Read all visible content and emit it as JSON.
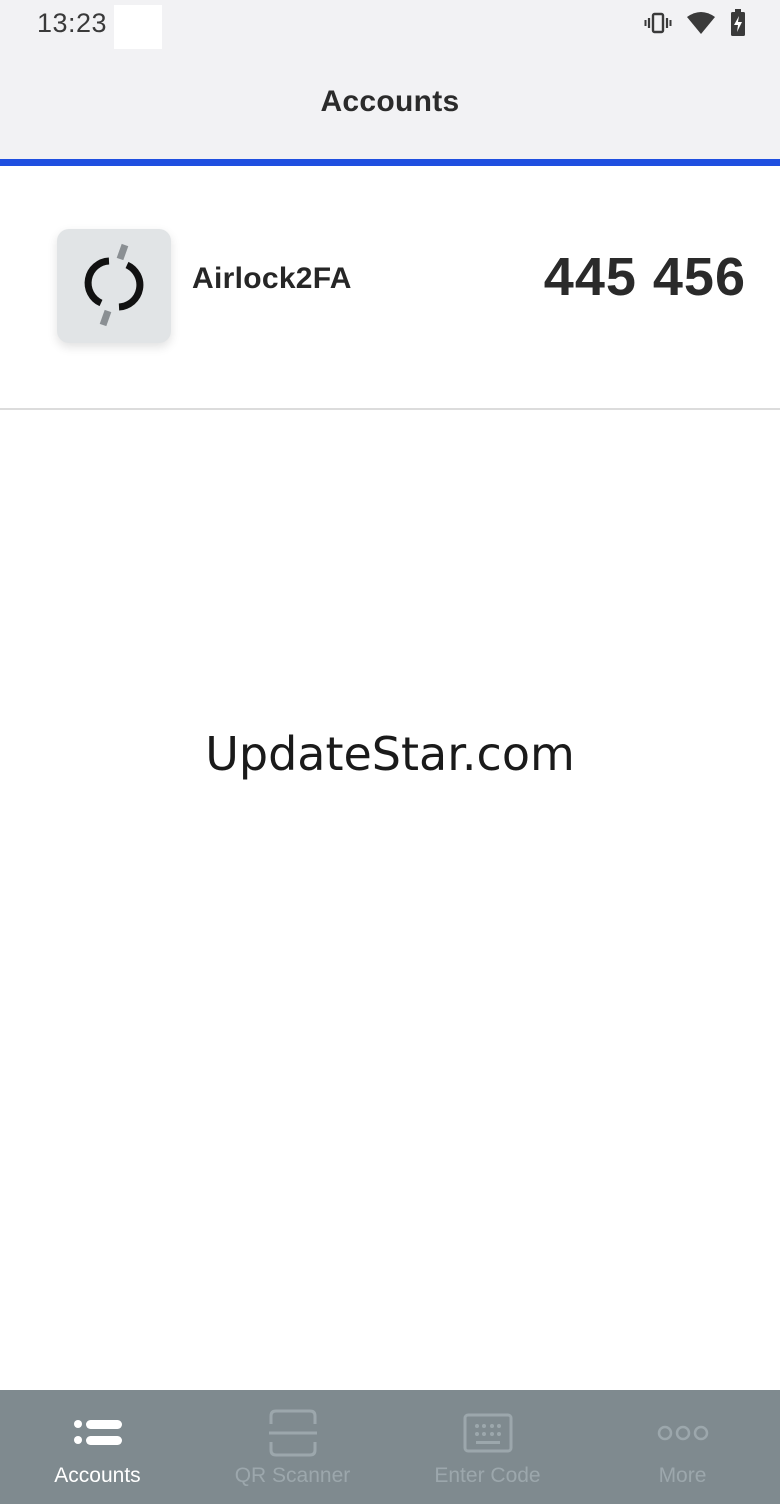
{
  "status_bar": {
    "time": "13:23",
    "icons": [
      "vibrate-icon",
      "wifi-icon",
      "battery-charging-icon"
    ]
  },
  "header": {
    "title": "Accounts"
  },
  "colors": {
    "accent": "#1f4fe0",
    "tab_bar_bg": "#7f8a8f",
    "tab_active": "#ffffff",
    "tab_inactive": "#9ca7ac"
  },
  "accounts": [
    {
      "name": "Airlock2FA",
      "code": "445 456",
      "icon": "airlock-logo-icon"
    }
  ],
  "watermark": "UpdateStar.com",
  "tabs": [
    {
      "label": "Accounts",
      "icon": "list-icon",
      "active": true
    },
    {
      "label": "QR Scanner",
      "icon": "qr-scanner-icon",
      "active": false
    },
    {
      "label": "Enter Code",
      "icon": "keypad-icon",
      "active": false
    },
    {
      "label": "More",
      "icon": "more-dots-icon",
      "active": false
    }
  ]
}
